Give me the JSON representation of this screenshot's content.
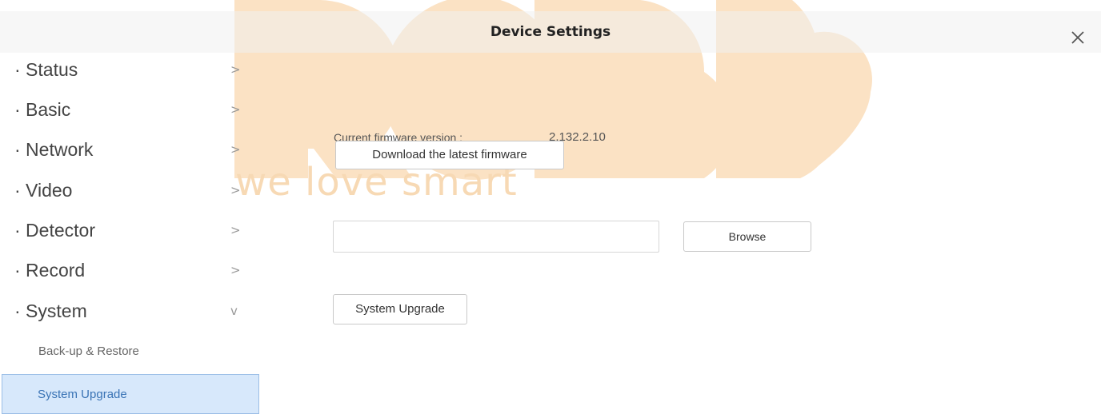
{
  "window": {
    "title": "Device Settings",
    "close_icon": "close-icon"
  },
  "watermark": {
    "brand": "ROBB",
    "tagline": "we love smart",
    "color": "#fbe2c4"
  },
  "sidebar": {
    "items": [
      {
        "label": "· Status",
        "arrow": ">",
        "expanded": false
      },
      {
        "label": "· Basic",
        "arrow": ">",
        "expanded": false
      },
      {
        "label": "· Network",
        "arrow": ">",
        "expanded": false
      },
      {
        "label": "· Video",
        "arrow": ">",
        "expanded": false
      },
      {
        "label": "· Detector",
        "arrow": ">",
        "expanded": false
      },
      {
        "label": "· Record",
        "arrow": ">",
        "expanded": false
      },
      {
        "label": "· System",
        "arrow": "v",
        "expanded": true
      }
    ],
    "sub_items": [
      {
        "label": "Back-up & Restore",
        "active": false
      },
      {
        "label": "System Upgrade",
        "active": true
      }
    ],
    "active_color": "#d7e8fb"
  },
  "main": {
    "firmware_label": "Current firmware version :",
    "firmware_version": "2.132.2.10",
    "download_button": "Download the latest firmware",
    "file_path": "",
    "browse_button": "Browse",
    "upgrade_button": "System Upgrade"
  }
}
